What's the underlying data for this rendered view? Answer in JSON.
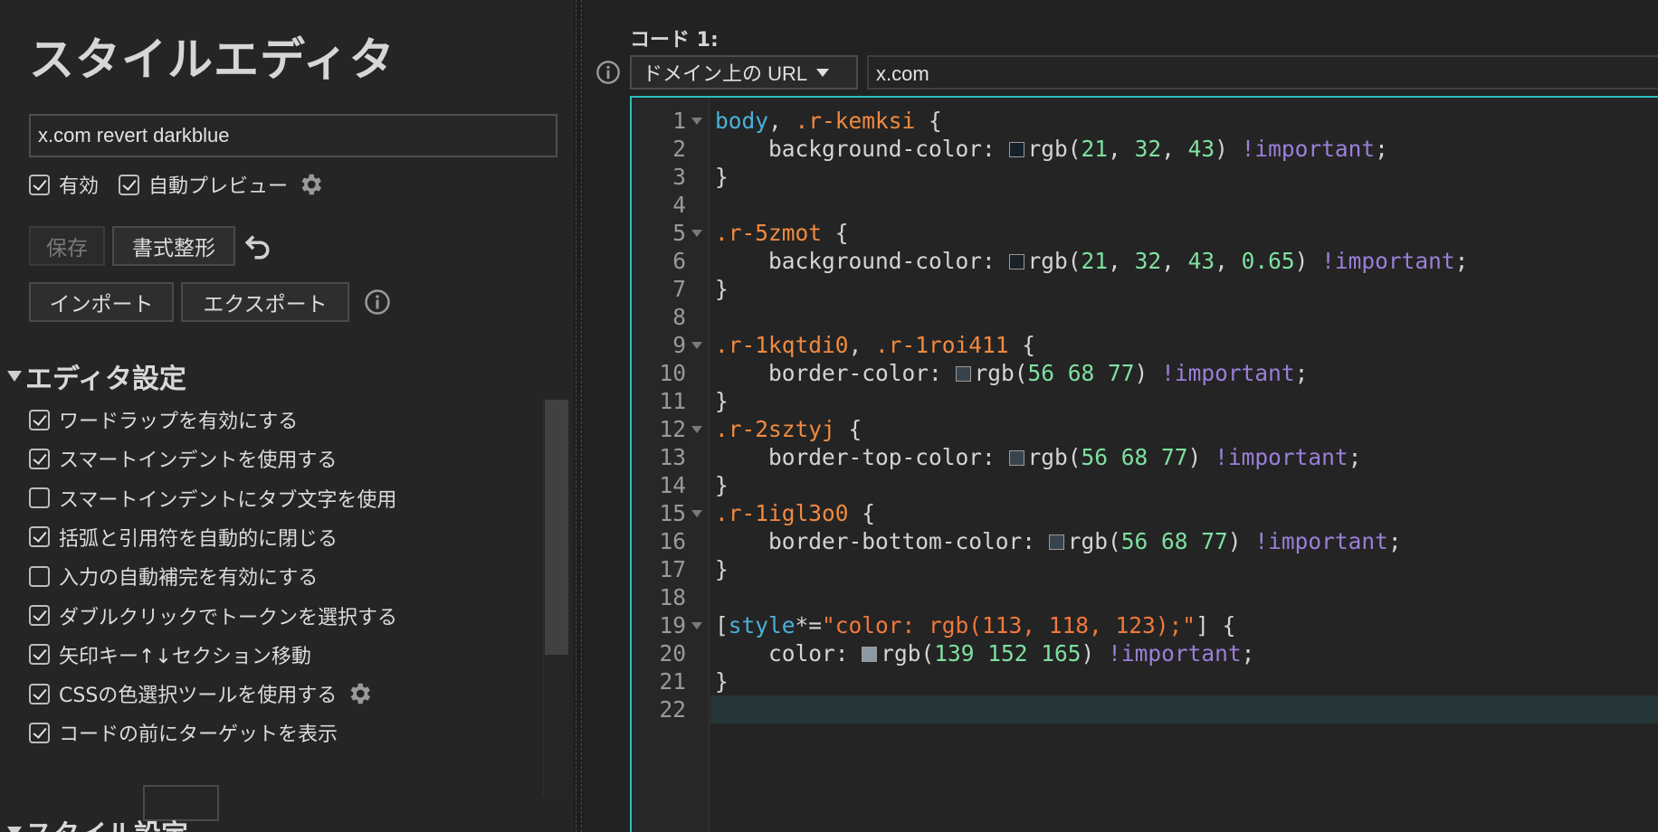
{
  "app_title": "スタイルエディタ",
  "style_name": "x.com revert darkblue",
  "toggles": {
    "enabled_label": "有効",
    "enabled": true,
    "autopreview_label": "自動プレビュー",
    "autopreview": true
  },
  "buttons": {
    "save": "保存",
    "format": "書式整形",
    "import": "インポート",
    "export": "エクスポート"
  },
  "editor_settings": {
    "title": "エディタ設定",
    "items": [
      {
        "label": "ワードラップを有効にする",
        "checked": true
      },
      {
        "label": "スマートインデントを使用する",
        "checked": true
      },
      {
        "label": "スマートインデントにタブ文字を使用",
        "checked": false
      },
      {
        "label": "括弧と引用符を自動的に閉じる",
        "checked": true
      },
      {
        "label": "入力の自動補完を有効にする",
        "checked": false
      },
      {
        "label": "ダブルクリックでトークンを選択する",
        "checked": true
      },
      {
        "label": "矢印キー↑↓セクション移動",
        "checked": true
      },
      {
        "label": "CSSの色選択ツールを使用する",
        "checked": true
      },
      {
        "label": "コードの前にターゲットを表示",
        "checked": true
      }
    ]
  },
  "style_settings_title": "スタイル設定",
  "code_section": {
    "heading": "コード 1:",
    "applies_to": "ドメイン上の URL",
    "applies_value": "x.com"
  },
  "editor": {
    "line_numbers": [
      "1",
      "2",
      "3",
      "4",
      "5",
      "6",
      "7",
      "8",
      "9",
      "10",
      "11",
      "12",
      "13",
      "14",
      "15",
      "16",
      "17",
      "18",
      "19",
      "20",
      "21",
      "22"
    ],
    "fold_lines": [
      1,
      5,
      9,
      12,
      15,
      19
    ],
    "active_line": 22,
    "lines": [
      [
        [
          "tag",
          "body"
        ],
        [
          "punc",
          ", "
        ],
        [
          "sel",
          ".r-kemksi"
        ],
        [
          "punc",
          " {"
        ]
      ],
      [
        [
          "prop",
          "    background-color: "
        ],
        [
          "sw",
          "#15202b"
        ],
        [
          "punc",
          "rgb("
        ],
        [
          "num",
          "21"
        ],
        [
          "punc",
          ", "
        ],
        [
          "num",
          "32"
        ],
        [
          "punc",
          ", "
        ],
        [
          "num",
          "43"
        ],
        [
          "punc",
          ") "
        ],
        [
          "imp",
          "!important"
        ],
        [
          "punc",
          ";"
        ]
      ],
      [
        [
          "punc",
          "}"
        ]
      ],
      [],
      [
        [
          "sel",
          ".r-5zmot"
        ],
        [
          "punc",
          " {"
        ]
      ],
      [
        [
          "prop",
          "    background-color: "
        ],
        [
          "sw",
          "#15202ba6"
        ],
        [
          "punc",
          "rgb("
        ],
        [
          "num",
          "21"
        ],
        [
          "punc",
          ", "
        ],
        [
          "num",
          "32"
        ],
        [
          "punc",
          ", "
        ],
        [
          "num",
          "43"
        ],
        [
          "punc",
          ", "
        ],
        [
          "num",
          "0.65"
        ],
        [
          "punc",
          ") "
        ],
        [
          "imp",
          "!important"
        ],
        [
          "punc",
          ";"
        ]
      ],
      [
        [
          "punc",
          "}"
        ]
      ],
      [],
      [
        [
          "sel",
          ".r-1kqtdi0"
        ],
        [
          "punc",
          ", "
        ],
        [
          "sel",
          ".r-1roi411"
        ],
        [
          "punc",
          " {"
        ]
      ],
      [
        [
          "prop",
          "    border-color: "
        ],
        [
          "sw",
          "#38444d"
        ],
        [
          "punc",
          "rgb("
        ],
        [
          "num",
          "56 68 77"
        ],
        [
          "punc",
          ") "
        ],
        [
          "imp",
          "!important"
        ],
        [
          "punc",
          ";"
        ]
      ],
      [
        [
          "punc",
          "}"
        ]
      ],
      [
        [
          "sel",
          ".r-2sztyj"
        ],
        [
          "punc",
          " {"
        ]
      ],
      [
        [
          "prop",
          "    border-top-color: "
        ],
        [
          "sw",
          "#38444d"
        ],
        [
          "punc",
          "rgb("
        ],
        [
          "num",
          "56 68 77"
        ],
        [
          "punc",
          ") "
        ],
        [
          "imp",
          "!important"
        ],
        [
          "punc",
          ";"
        ]
      ],
      [
        [
          "punc",
          "}"
        ]
      ],
      [
        [
          "sel",
          ".r-1igl3o0"
        ],
        [
          "punc",
          " {"
        ]
      ],
      [
        [
          "prop",
          "    border-bottom-color: "
        ],
        [
          "sw",
          "#38444d"
        ],
        [
          "punc",
          "rgb("
        ],
        [
          "num",
          "56 68 77"
        ],
        [
          "punc",
          ") "
        ],
        [
          "imp",
          "!important"
        ],
        [
          "punc",
          ";"
        ]
      ],
      [
        [
          "punc",
          "}"
        ]
      ],
      [],
      [
        [
          "punc",
          "["
        ],
        [
          "tag",
          "style"
        ],
        [
          "punc",
          "*="
        ],
        [
          "str",
          "\"color: rgb(113, 118, 123);\""
        ],
        [
          "punc",
          "] {"
        ]
      ],
      [
        [
          "prop",
          "    color: "
        ],
        [
          "sw",
          "#8b98a5"
        ],
        [
          "punc",
          "rgb("
        ],
        [
          "num",
          "139 152 165"
        ],
        [
          "punc",
          ") "
        ],
        [
          "imp",
          "!important"
        ],
        [
          "punc",
          ";"
        ]
      ],
      [
        [
          "punc",
          "}"
        ]
      ],
      []
    ]
  },
  "colors": {
    "accent_border": "#2bbfbf",
    "selector": "#f08a40",
    "tag": "#4ab0d8",
    "number": "#7fe0a0",
    "important": "#9a7fd8"
  },
  "icons": [
    "settings-gear-icon",
    "undo-icon",
    "info-icon",
    "dropdown-caret-icon",
    "fold-arrow-icon"
  ]
}
